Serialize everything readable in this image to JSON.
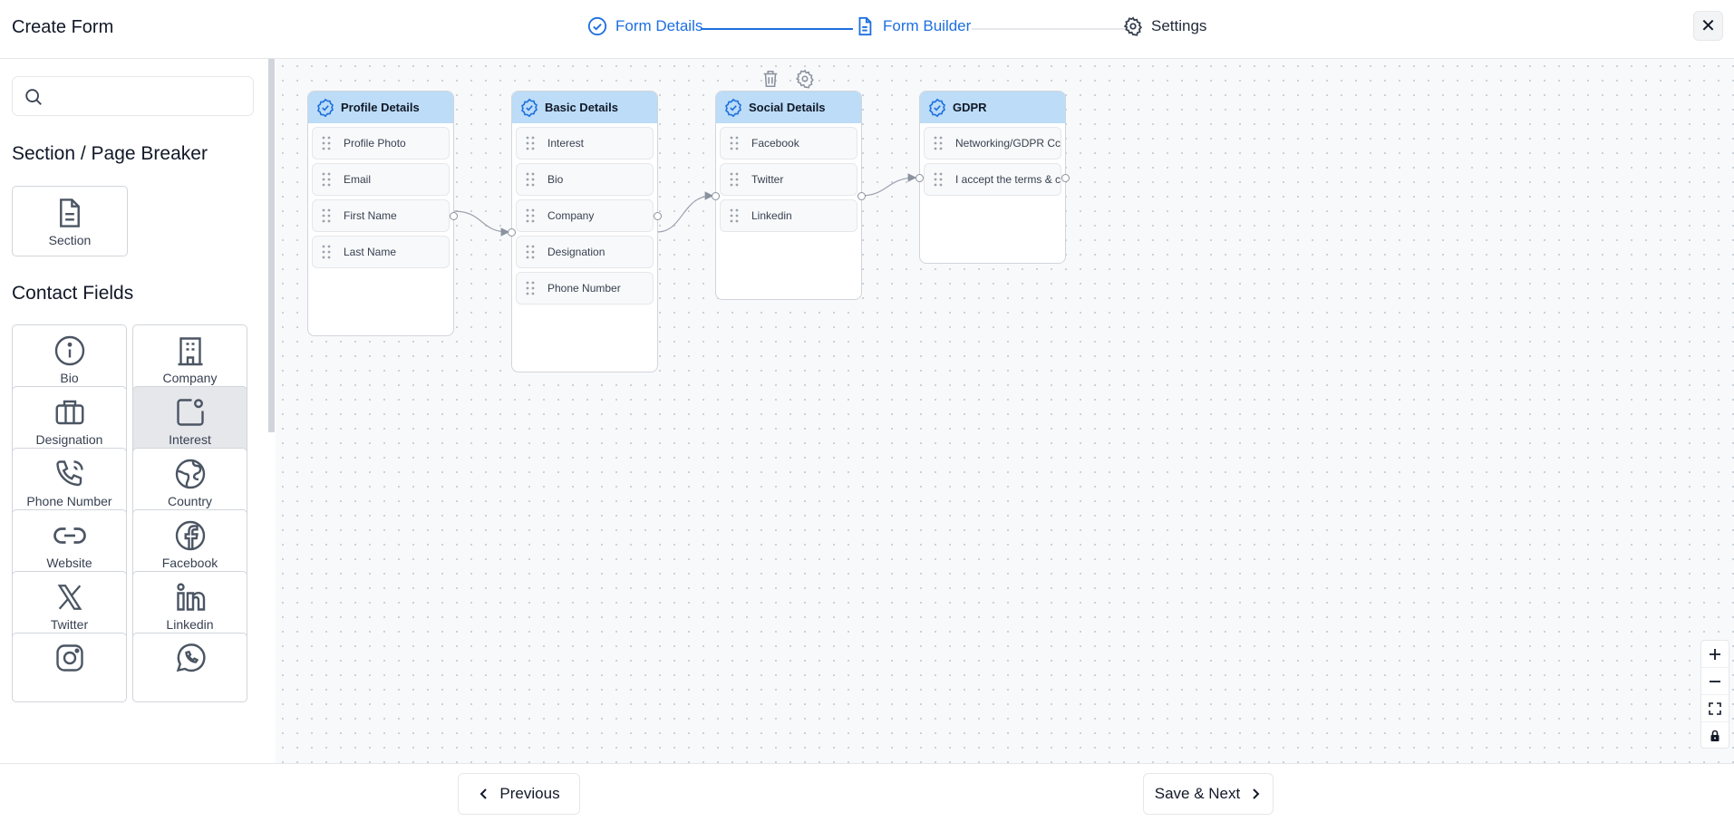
{
  "header": {
    "title": "Create Form",
    "steps": [
      {
        "label": "Form Details",
        "icon": "check-circle-icon",
        "state": "completed"
      },
      {
        "label": "Form Builder",
        "icon": "document-icon",
        "state": "active"
      },
      {
        "label": "Settings",
        "icon": "gear-icon",
        "state": "upcoming"
      }
    ],
    "close_label": "✕"
  },
  "colors": {
    "accent": "#1d6fe0",
    "node_header": "#bcdcf7",
    "selected_tile": "#e5e7eb"
  },
  "sidebar": {
    "search": {
      "placeholder": "",
      "value": ""
    },
    "section_breaker": {
      "title": "Section / Page Breaker",
      "items": [
        {
          "label": "Section",
          "icon": "document-icon"
        }
      ]
    },
    "contact_fields": {
      "title": "Contact Fields",
      "items": [
        {
          "label": "Bio",
          "icon": "info-icon"
        },
        {
          "label": "Company",
          "icon": "building-icon"
        },
        {
          "label": "Designation",
          "icon": "briefcase-icon"
        },
        {
          "label": "Interest",
          "icon": "interest-icon",
          "selected": true
        },
        {
          "label": "Phone Number",
          "icon": "phone-icon"
        },
        {
          "label": "Country",
          "icon": "globe-icon"
        },
        {
          "label": "Website",
          "icon": "link-icon"
        },
        {
          "label": "Facebook",
          "icon": "facebook-icon"
        },
        {
          "label": "Twitter",
          "icon": "x-twitter-icon"
        },
        {
          "label": "Linkedin",
          "icon": "linkedin-icon"
        },
        {
          "label": "",
          "icon": "instagram-icon"
        },
        {
          "label": "",
          "icon": "whatsapp-icon"
        }
      ]
    }
  },
  "canvas": {
    "toolbar": [
      {
        "icon": "trash-icon"
      },
      {
        "icon": "gear-icon"
      }
    ],
    "nodes": [
      {
        "title": "Profile Details",
        "fields": [
          "Profile Photo",
          "Email",
          "First Name",
          "Last Name"
        ]
      },
      {
        "title": "Basic Details",
        "fields": [
          "Interest",
          "Bio",
          "Company",
          "Designation",
          "Phone Number"
        ]
      },
      {
        "title": "Social Details",
        "fields": [
          "Facebook",
          "Twitter",
          "Linkedin"
        ]
      },
      {
        "title": "GDPR",
        "fields": [
          "Networking/GDPR Cc",
          "I accept the terms & c"
        ]
      }
    ],
    "zoom_controls": [
      {
        "icon": "plus-icon"
      },
      {
        "icon": "minus-icon"
      },
      {
        "icon": "fit-view-icon"
      },
      {
        "icon": "lock-icon"
      }
    ]
  },
  "footer": {
    "previous_label": "Previous",
    "next_label": "Save & Next"
  }
}
